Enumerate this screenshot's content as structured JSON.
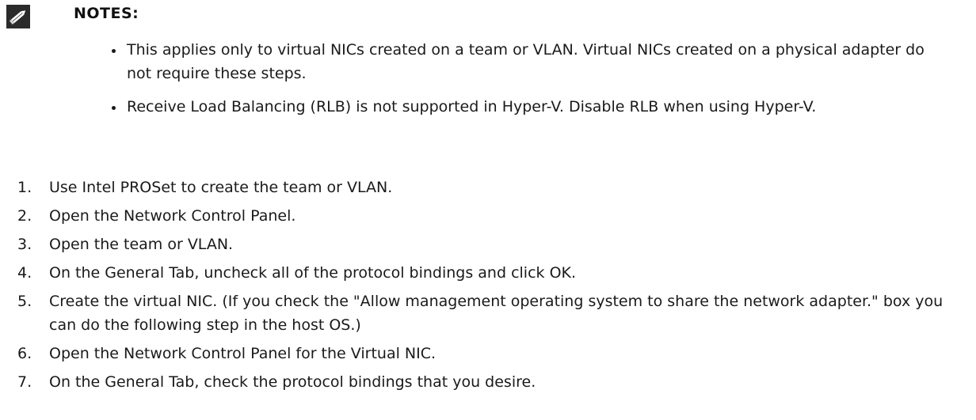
{
  "notes": {
    "heading": "NOTES:",
    "icon": "pencil-icon",
    "items": [
      {
        "text": "This applies only to virtual NICs created on a team or VLAN. Virtual NICs created on a physical adapter do not require these steps."
      },
      {
        "text": "Receive Load Balancing (RLB) is not supported in Hyper-V. Disable RLB when using Hyper-V."
      }
    ]
  },
  "steps": [
    {
      "num": "1.",
      "text": "Use Intel PROSet to create the team or VLAN."
    },
    {
      "num": "2.",
      "text": "Open the Network Control Panel."
    },
    {
      "num": "3.",
      "text": "Open the team or VLAN."
    },
    {
      "num": "4.",
      "text": "On the General Tab, uncheck all of the protocol bindings and click OK."
    },
    {
      "num": "5.",
      "text": "Create the virtual NIC. (If you check the \"Allow management operating system to share the network adapter.\" box you can do the following step in the host OS.)"
    },
    {
      "num": "6.",
      "text": "Open the Network Control Panel for the Virtual NIC."
    },
    {
      "num": "7.",
      "text": "On the General Tab, check the protocol bindings that you desire."
    }
  ]
}
